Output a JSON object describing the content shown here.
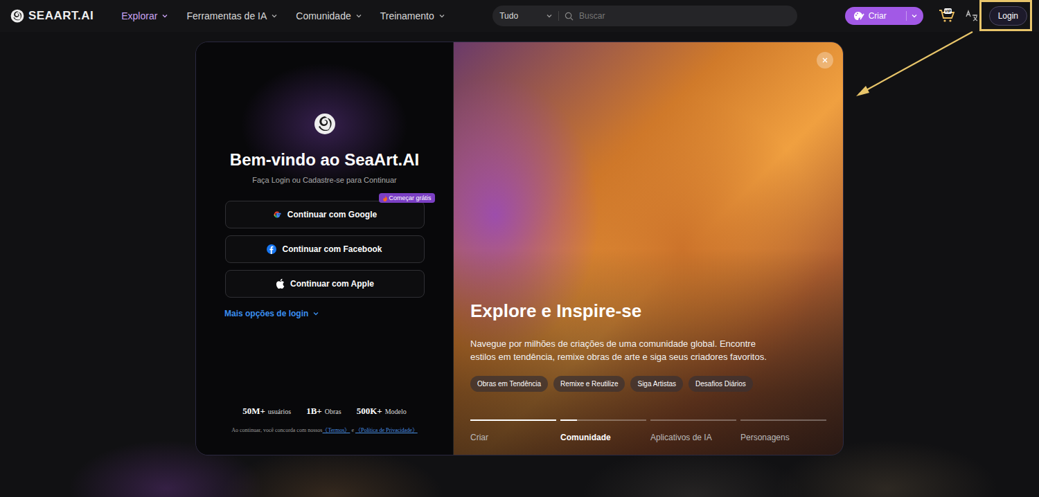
{
  "nav": {
    "logo": "SEAART.AI",
    "items": [
      {
        "label": "Explorar",
        "selected": true
      },
      {
        "label": "Ferramentas de IA",
        "selected": false
      },
      {
        "label": "Comunidade",
        "selected": false
      },
      {
        "label": "Treinamento",
        "selected": false
      }
    ],
    "search": {
      "scope": "Tudo",
      "placeholder": "Buscar"
    },
    "create_button": "Criar",
    "vip_label": "VIP",
    "login_button": "Login"
  },
  "modal": {
    "title": "Bem-vindo ao SeaArt.AI",
    "subtitle": "Faça Login ou Cadastre-se para Continuar",
    "login_options": [
      {
        "label": "Continuar com Google",
        "badge": "Começar grátis",
        "kind": "google"
      },
      {
        "label": "Continuar com Facebook",
        "badge": "",
        "kind": "facebook"
      },
      {
        "label": "Continuar com Apple",
        "badge": "",
        "kind": "apple"
      }
    ],
    "more_options": "Mais opções de login",
    "stats": [
      {
        "value": "50M+",
        "label": "usuários"
      },
      {
        "value": "1B+",
        "label": "Obras"
      },
      {
        "value": "500K+",
        "label": "Modelo"
      }
    ],
    "terms": {
      "prefix": "Ao continuar, você concorda com nossos",
      "terms_link": "《Termos》",
      "conjunction": "e",
      "privacy_link": "《Política de Privacidade》"
    },
    "feature": {
      "title": "Explore e Inspire-se",
      "description": "Navegue por milhões de criações de uma comunidade global. Encontre estilos em tendência, remixe obras de arte e siga seus criadores favoritos.",
      "tags": [
        "Obras em Tendência",
        "Remixe e Reutilize",
        "Siga Artistas",
        "Desafios Diários"
      ]
    },
    "carousel": [
      {
        "label": "Criar",
        "selected": false,
        "level": 1
      },
      {
        "label": "Comunidade",
        "selected": true,
        "level": 0.19
      },
      {
        "label": "Aplicativos de IA",
        "selected": false,
        "level": 0
      },
      {
        "label": "Personagens",
        "selected": false,
        "level": 0
      }
    ]
  }
}
